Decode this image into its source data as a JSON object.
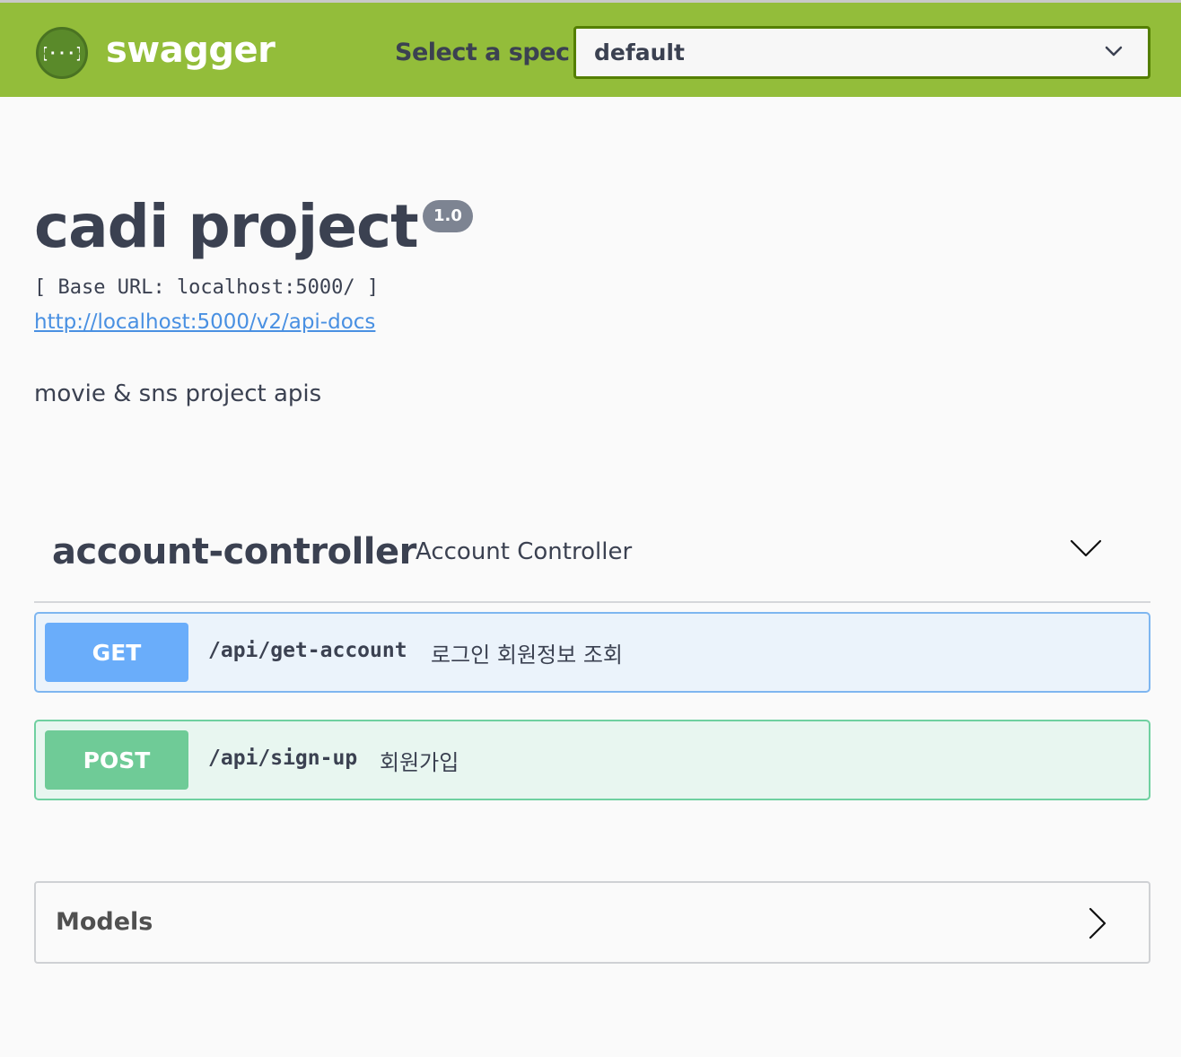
{
  "topbar": {
    "logo_icon": "swagger-braces-icon",
    "logo_glyph": "{···}",
    "logo_text": "swagger",
    "spec_label": "Select a spec",
    "spec_selected": "default",
    "spec_chevron_icon": "chevron-down-icon",
    "colors": {
      "bar": "#93bd3a",
      "select_border": "#547f00"
    }
  },
  "info": {
    "title": "cadi project",
    "version": "1.0",
    "base_url": "[ Base URL: localhost:5000/ ]",
    "docs_link": "http://localhost:5000/v2/api-docs",
    "description": "movie & sns project apis"
  },
  "tags": [
    {
      "name": "account-controller",
      "description": "Account Controller",
      "expand_icon": "chevron-down-icon",
      "operations": [
        {
          "method": "GET",
          "path": "/api/get-account",
          "summary": "로그인 회원정보 조회",
          "color": "#61affe"
        },
        {
          "method": "POST",
          "path": "/api/sign-up",
          "summary": "회원가입",
          "color": "#49cc90"
        }
      ]
    }
  ],
  "models": {
    "label": "Models",
    "expand_icon": "chevron-right-icon"
  }
}
